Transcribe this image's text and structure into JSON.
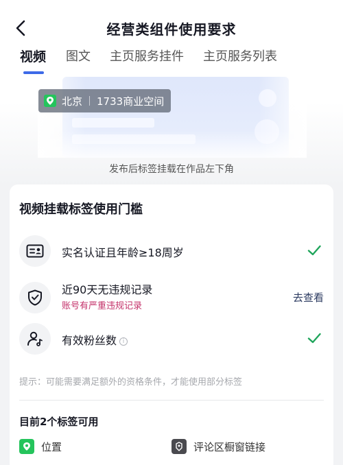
{
  "header": {
    "title": "经营类组件使用要求"
  },
  "tabs": [
    {
      "label": "视频",
      "active": true
    },
    {
      "label": "图文",
      "active": false
    },
    {
      "label": "主页服务挂件",
      "active": false
    },
    {
      "label": "主页服务列表",
      "active": false
    }
  ],
  "preview": {
    "location_city": "北京",
    "location_place": "1733商业空间",
    "caption": "发布后标签挂载在作品左下角"
  },
  "threshold_card": {
    "title": "视频挂载标签使用门槛",
    "requirements": [
      {
        "icon": "id-card-icon",
        "text": "实名认证且年龄≥18周岁",
        "status": "met"
      },
      {
        "icon": "shield-check-icon",
        "text": "近90天无违规记录",
        "sub_text": "账号有严重违规记录",
        "action": "去查看",
        "status": "unmet"
      },
      {
        "icon": "fans-icon",
        "text": "有效粉丝数",
        "status": "met"
      }
    ],
    "hint": "提示：可能需要满足额外的资格条件，才能使用部分标签",
    "available_title": "目前2个标签可用",
    "available_tags": [
      {
        "icon": "location-pin-icon",
        "label": "位置",
        "color": "#25c45c"
      },
      {
        "icon": "shop-window-icon",
        "label": "评论区橱窗链接",
        "color": "#4a4a4f"
      }
    ]
  },
  "colors": {
    "accent": "#3d6ae8",
    "check_green": "#1fa55b",
    "warning_red": "#c4326a"
  }
}
